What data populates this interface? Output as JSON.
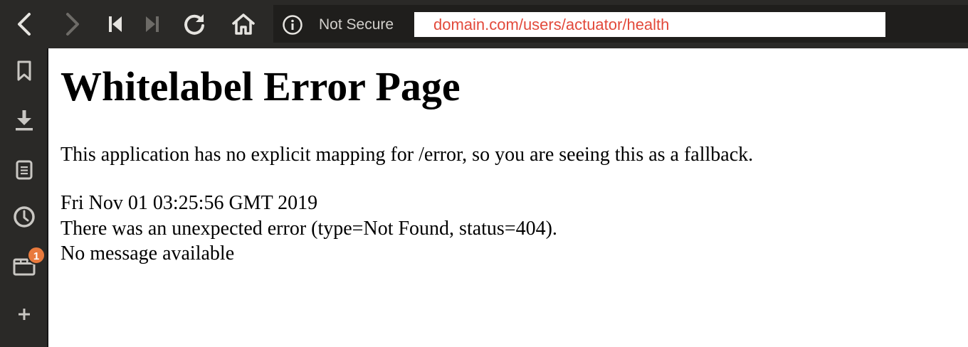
{
  "toolbar": {
    "back_icon": "chevron-left-icon",
    "forward_icon": "chevron-right-icon",
    "rewind_icon": "skip-back-icon",
    "fastforward_icon": "skip-forward-icon",
    "reload_icon": "reload-icon",
    "home_icon": "home-icon",
    "security_icon": "info-icon",
    "security_label": "Not Secure",
    "url": "domain.com/users/actuator/health",
    "url_color": "#e24a3b"
  },
  "sidebar": {
    "items": [
      {
        "icon": "bookmark-icon"
      },
      {
        "icon": "download-icon"
      },
      {
        "icon": "notes-icon"
      },
      {
        "icon": "history-icon"
      },
      {
        "icon": "window-icon",
        "badge": "1"
      },
      {
        "icon": "plus-icon"
      }
    ],
    "badge_color": "#e97a3d"
  },
  "page": {
    "title": "Whitelabel Error Page",
    "explanation": "This application has no explicit mapping for /error, so you are seeing this as a fallback.",
    "timestamp": "Fri Nov 01 03:25:56 GMT 2019",
    "error_detail": "There was an unexpected error (type=Not Found, status=404).",
    "message": "No message available"
  }
}
